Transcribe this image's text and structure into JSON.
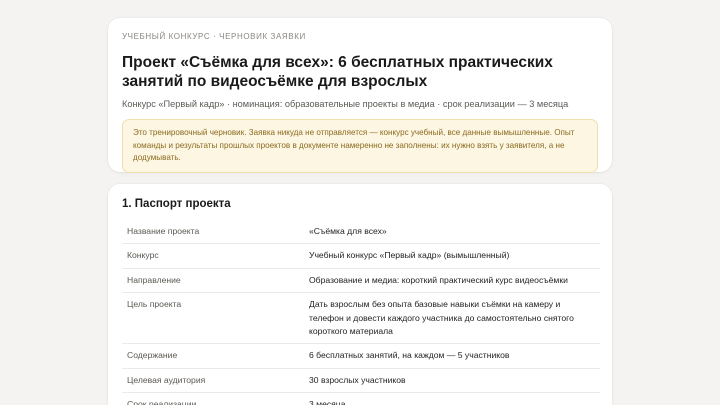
{
  "header": {
    "eyebrow": "УЧЕБНЫЙ КОНКУРС · ЧЕРНОВИК ЗАЯВКИ",
    "title": "Проект «Съёмка для всех»: 6 бесплатных практических занятий по видеосъёмке для взрослых",
    "meta": "Конкурс «Первый кадр» · номинация: образовательные проекты в медиа · срок реализации — 3 месяца",
    "notice": "Это тренировочный черновик. Заявка никуда не отправляется — конкурс учебный, все данные вымышленные. Опыт команды и результаты прошлых проектов в документе намеренно не заполнены: их нужно взять у заявителя, а не додумывать."
  },
  "passport": {
    "title": "1. Паспорт проекта",
    "rows": [
      {
        "label": "Название проекта",
        "value": "«Съёмка для всех»"
      },
      {
        "label": "Конкурс",
        "value": "Учебный конкурс «Первый кадр» (вымышленный)"
      },
      {
        "label": "Направление",
        "value": "Образование и медиа: короткий практический курс видеосъёмки"
      },
      {
        "label": "Цель проекта",
        "value": "Дать взрослым без опыта базовые навыки съёмки на камеру и телефон и довести каждого участника до самостоятельно снятого короткого материала"
      },
      {
        "label": "Содержание",
        "value": "6 бесплатных занятий, на каждом — 5 участников"
      },
      {
        "label": "Целевая аудитория",
        "value": "30 взрослых участников"
      },
      {
        "label": "Срок реализации",
        "value": "3 месяца"
      }
    ]
  }
}
